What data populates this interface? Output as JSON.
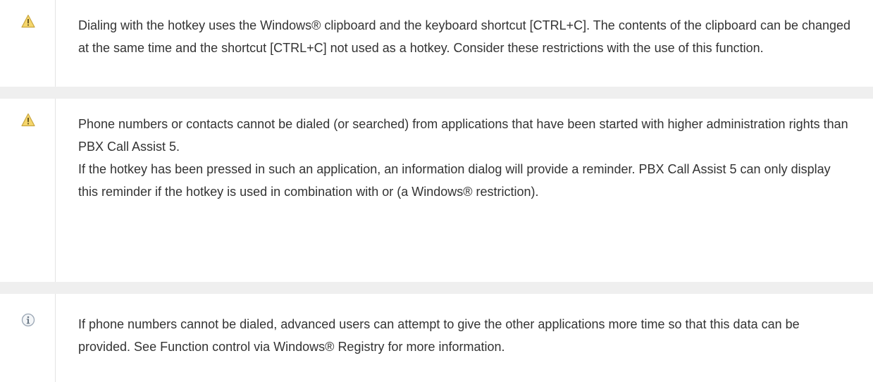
{
  "notes": [
    {
      "icon": "warning-icon",
      "text": "Dialing with the hotkey uses the Windows® clipboard and the keyboard shortcut [CTRL+C]. The contents of the clipboard can be changed at the same time and the shortcut [CTRL+C] not used as a hotkey. Consider these restrictions with the use of this function."
    },
    {
      "icon": "warning-icon",
      "text_1": "Phone numbers or contacts cannot be dialed (or searched) from applications that have been started with higher administration rights than PBX Call Assist 5.",
      "text_2": "If the hotkey has been pressed in such an application, an information dialog will provide a reminder. PBX Call Assist 5 can only display this reminder if the hotkey is used in combination with or (a Windows® restriction)."
    },
    {
      "icon": "info-icon",
      "text": "If phone numbers cannot be dialed, advanced users can attempt to give the other applications more time so that this data can be provided. See Function control via Windows® Registry for more information."
    }
  ],
  "colors": {
    "text": "#333333",
    "divider": "#efefef",
    "warning_fill": "#f5d66b",
    "warning_stroke": "#c9a640",
    "info_stroke": "#9aa6b4"
  }
}
